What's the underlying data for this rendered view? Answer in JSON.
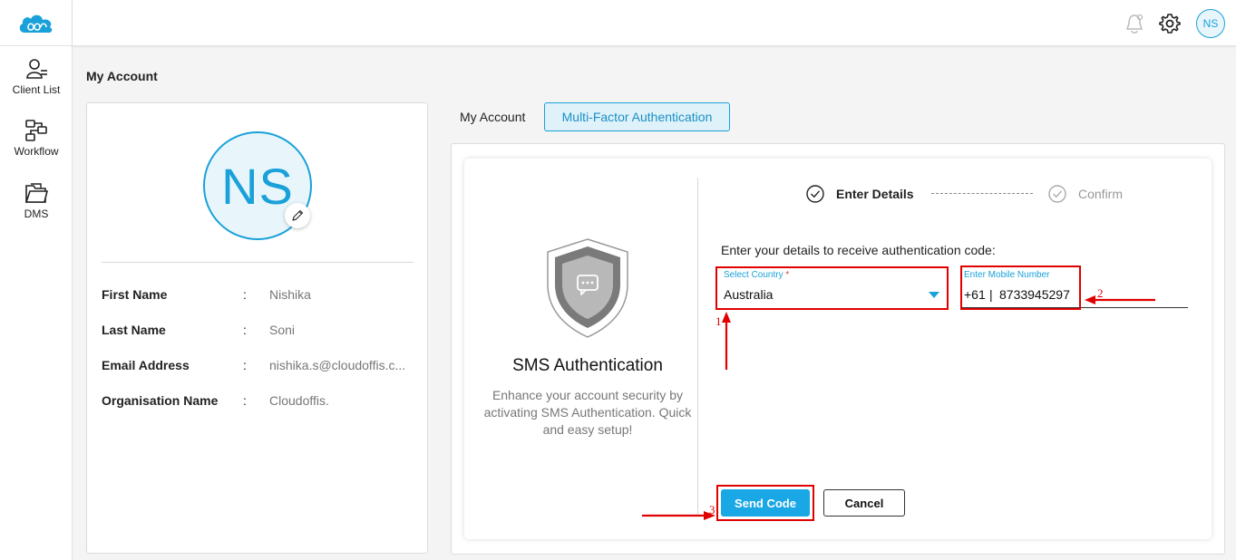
{
  "colors": {
    "accent": "#1aa1d9",
    "annotation": "#e00000",
    "send_button": "#1aa7e6"
  },
  "sidebar": {
    "items": [
      {
        "label": "Client List",
        "icon": "client-list-icon"
      },
      {
        "label": "Workflow",
        "icon": "workflow-icon"
      },
      {
        "label": "DMS",
        "icon": "dms-folder-icon"
      }
    ]
  },
  "topbar": {
    "user_initials": "NS",
    "icons": [
      "notification-bell-icon",
      "settings-gear-icon"
    ]
  },
  "page_title": "My Account",
  "profile": {
    "initials": "NS",
    "fields": [
      {
        "label": "First Name",
        "colon": ":",
        "value": "Nishika"
      },
      {
        "label": "Last Name",
        "colon": ":",
        "value": "Soni"
      },
      {
        "label": "Email Address",
        "colon": ":",
        "value": "nishika.s@cloudoffis.c..."
      },
      {
        "label": "Organisation Name",
        "colon": ":",
        "value": "Cloudoffis."
      }
    ]
  },
  "tabs": [
    {
      "label": "My Account",
      "active": false
    },
    {
      "label": "Multi-Factor Authentication",
      "active": true
    }
  ],
  "mfa": {
    "title": "SMS Authentication",
    "description": "Enhance your account security by activating SMS Authentication. Quick and easy setup!",
    "steps": [
      {
        "label": "Enter Details",
        "active": true
      },
      {
        "label": "Confirm",
        "active": false
      }
    ],
    "instruction": "Enter your details to receive authentication code:",
    "country_label": "Select Country",
    "required_mark": "*",
    "country_value": "Australia",
    "mobile_label": "Enter Mobile Number",
    "mobile_code": "+61",
    "mobile_separator": "|",
    "mobile_value": "8733945297",
    "send_label": "Send Code",
    "cancel_label": "Cancel"
  },
  "annotations": {
    "numbers": [
      "1",
      "2",
      "3"
    ]
  }
}
